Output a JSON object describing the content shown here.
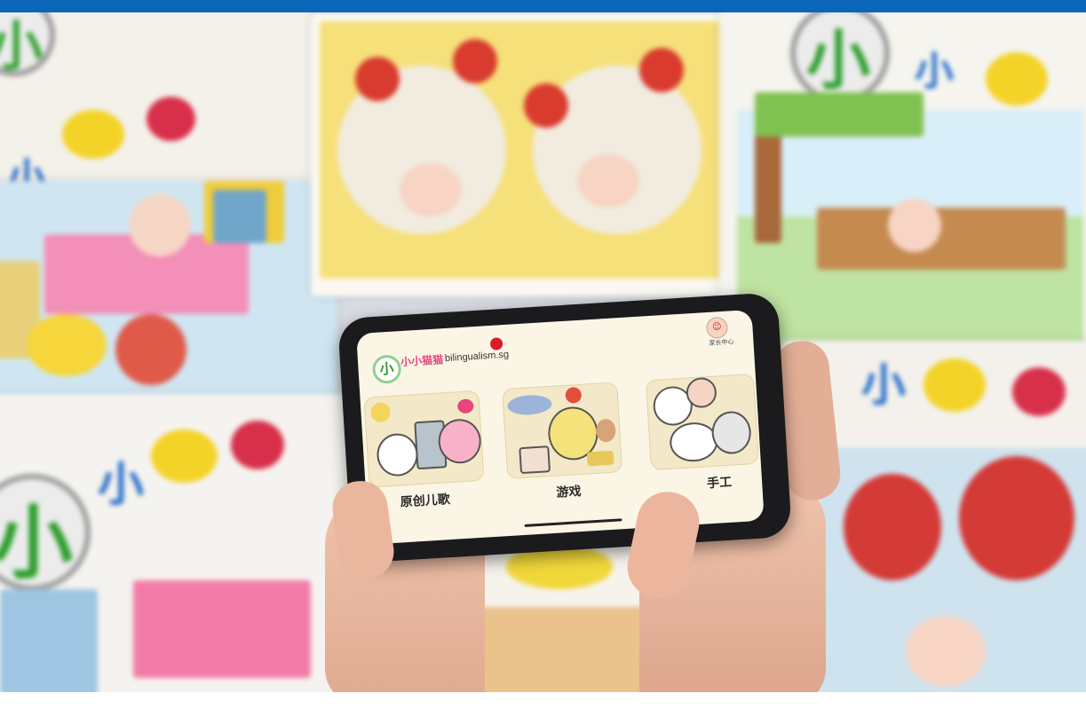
{
  "app": {
    "logo_glyph": "小",
    "logo_text": "小小猫猫",
    "brand": "bilingualism.sg",
    "parent_label": "家长中心"
  },
  "menu": [
    {
      "label": "原创儿歌",
      "icon": "songs-illustration"
    },
    {
      "label": "游戏",
      "icon": "games-illustration"
    },
    {
      "label": "手工",
      "icon": "crafts-illustration"
    }
  ],
  "background": {
    "poster_glyph": "小"
  },
  "colors": {
    "top_bar": "#0a66b8",
    "accent_red": "#d81b2b",
    "logo_green": "#2e9e2e"
  }
}
